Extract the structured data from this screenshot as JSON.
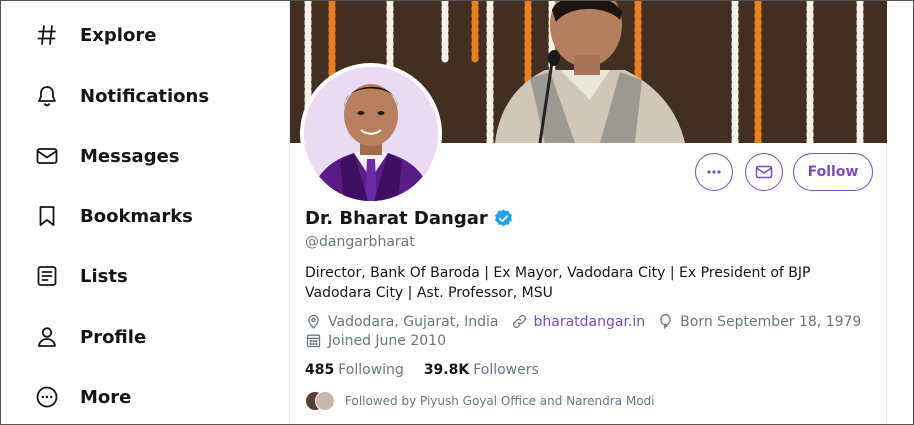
{
  "sidebar": {
    "items": [
      {
        "label": "Explore",
        "icon": "hashtag-icon"
      },
      {
        "label": "Notifications",
        "icon": "bell-icon"
      },
      {
        "label": "Messages",
        "icon": "envelope-icon"
      },
      {
        "label": "Bookmarks",
        "icon": "bookmark-icon"
      },
      {
        "label": "Lists",
        "icon": "list-icon"
      },
      {
        "label": "Profile",
        "icon": "person-icon"
      },
      {
        "label": "More",
        "icon": "more-circle-icon"
      }
    ]
  },
  "profile": {
    "name": "Dr. Bharat Dangar",
    "handle": "@dangarbharat",
    "bio": "Director, Bank Of Baroda | Ex Mayor, Vadodara City | Ex President of BJP Vadodara City | Ast. Professor, MSU",
    "location": "Vadodara, Gujarat, India",
    "website": "bharatdangar.in",
    "born": "Born September 18, 1979",
    "joined": "Joined June 2010",
    "following_count": "485",
    "following_label": "Following",
    "followers_count": "39.8K",
    "followers_label": "Followers",
    "followed_by": "Followed by Piyush Goyal Office and Narendra Modi"
  },
  "actions": {
    "follow_label": "Follow",
    "more_icon": "more-horizontal-icon",
    "message_icon": "envelope-icon"
  },
  "colors": {
    "accent": "#794bc4",
    "verified": "#1da1f2",
    "secondary_text": "#657786"
  }
}
